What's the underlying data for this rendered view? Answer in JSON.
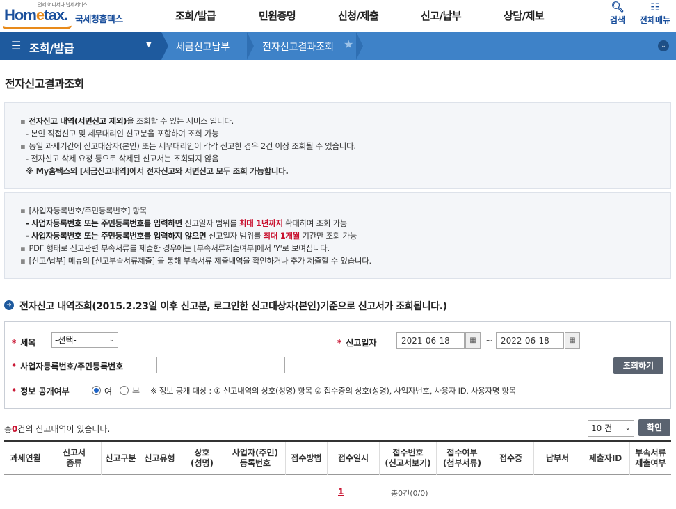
{
  "header": {
    "logo_tiny": "언제 어디서나 납세서비스",
    "logo_home_a": "Hom",
    "logo_home_e": "e",
    "logo_home_b": "tax.",
    "logo_name": "국세청홈택스",
    "menu": [
      "조회/발급",
      "민원증명",
      "신청/제출",
      "신고/납부",
      "상담/제보"
    ],
    "search_label": "검색",
    "allmenu_label": "전체메뉴"
  },
  "nav": {
    "menu_title": "조회/발급",
    "crumb1": "세금신고납부",
    "crumb2": "전자신고결과조회"
  },
  "page_title": "전자신고결과조회",
  "info1": {
    "l1_bold": "전자신고 내역(서면신고 제외)",
    "l1_rest": "을 조회할 수 있는 서비스 입니다.",
    "l2": "- 본인 직접신고 및 세무대리인 신고분을 포함하여 조회 가능",
    "l3": "동일 과세기간에 신고대상자(본인) 또는 세무대리인이 각각 신고한 경우 2건 이상 조회될 수 있습니다.",
    "l4": "- 전자신고 삭제 요청 등으로 삭제된 신고서는 조회되지 않음",
    "l5": "※ My홈택스의 [세금신고내역]에서 전자신고와 서면신고 모두 조회 가능합니다."
  },
  "info2": {
    "l1": "[사업자등록번호/주민등록번호] 항목",
    "l2_bold": "- 사업자등록번호 또는 주민등록번호를 입력하면",
    "l2_mid": " 신고일자 범위를 ",
    "l2_red": "최대 1년까지",
    "l2_end": " 확대하여 조회 가능",
    "l3_bold": "- 사업자등록번호 또는 주민등록번호를 입력하지 않으면",
    "l3_mid": " 신고일자 범위를 ",
    "l3_red": "최대 1개월",
    "l3_end": " 기간만 조회 가능",
    "l4": "PDF 형태로 신고관련 부속서류를 제출한 경우에는 [부속서류제출여부]에서 'Y'로 보여집니다.",
    "l5": "[신고/납부] 메뉴의 [신고부속서류제출] 을 통해 부속서류 제출내역을 확인하거나 추가 제출할 수 있습니다."
  },
  "section_heading": "전자신고 내역조회(2015.2.23일 이후 신고분, 로그인한  신고대상자(본인)기준으로  신고서가 조회됩니다.)",
  "form": {
    "tax_label": "세목",
    "tax_value": "-선택-",
    "date_label": "신고일자",
    "date_from": "2021-06-18",
    "date_sep": "~",
    "date_to": "2022-06-18",
    "bizno_label": "사업자등록번호/주민등록번호",
    "bizno_value": "",
    "search_btn": "조회하기",
    "public_label": "정보 공개여부",
    "radio_yes": "여",
    "radio_no": "부",
    "public_note": "※ 정보 공개 대상 : ① 신고내역의 상호(성명) 항목 ② 접수증의 상호(성명), 사업자번호, 사용자 ID, 사용자명 항목"
  },
  "result": {
    "count_pre": "총",
    "count_n": "0",
    "count_post": "건의 신고내역이 있습니다.",
    "page_size": "10 건",
    "confirm_btn": "확인"
  },
  "table": {
    "headers": [
      "과세연월",
      "신고서\n종류",
      "신고구분",
      "신고유형",
      "상호\n(성명)",
      "사업자(주민)\n등록번호",
      "접수방법",
      "접수일시",
      "접수번호\n(신고서보기)",
      "접수여부\n(첨부서류)",
      "접수증",
      "납부서",
      "제출자ID",
      "부속서류\n제출여부"
    ]
  },
  "pager": {
    "page": "1",
    "total": "총0건(0/0)"
  },
  "colors": {
    "nav_blue": "#3e82c8",
    "nav_dark": "#1e5a9e",
    "accent_red": "#c8102e"
  }
}
